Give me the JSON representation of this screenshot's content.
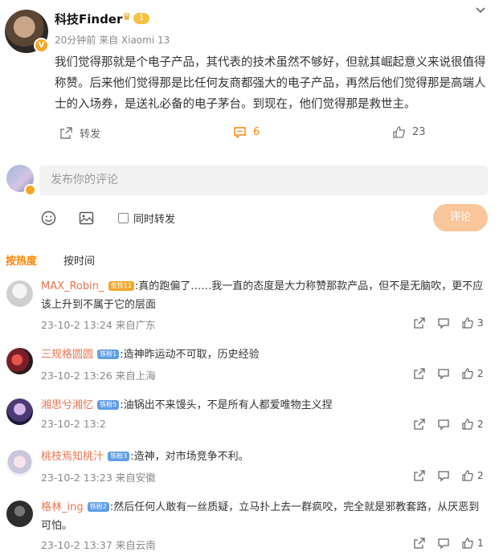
{
  "post": {
    "username": "科技Finder",
    "level": "1",
    "verified": "V",
    "time_source": "20分钟前  来自 Xiaomi 13",
    "body": "我们觉得那就是个电子产品，其代表的技术虽然不够好，但就其崛起意义来说很值得称赞。后来他们觉得那是比任何友商都强大的电子产品，再然后他们觉得那是高端人士的入场券，是送礼必备的电子茅台。到现在，他们觉得那是救世主。",
    "actions": {
      "repost_label": "转发",
      "comment_count": "6",
      "like_count": "23"
    }
  },
  "composer": {
    "placeholder": "发布你的评论",
    "also_repost_label": "同时转发",
    "submit_label": "评论"
  },
  "sort": {
    "hot_label": "按热度",
    "time_label": "按时间"
  },
  "comments": [
    {
      "name": "MAX_Robin_",
      "badge": "金铁11",
      "badge_color": "#f0a830",
      "text": ":真的跑偏了……我一直的态度是大力称赞那款产品，但不是无脑吹，更不应该上升到不属于它的层面",
      "time": "23-10-2 13:24 来自广东",
      "likes": "3"
    },
    {
      "name": "三规格圆圆",
      "badge": "铁粉1",
      "badge_color": "#5f9de8",
      "text": ":造神昨运动不可取，历史经验",
      "time": "23-10-2 13:26 来自上海",
      "likes": "2"
    },
    {
      "name": "湘思兮湘忆",
      "badge": "铁粉5",
      "badge_color": "#5f9de8",
      "text": ":油锅出不来馒头，不是所有人都爱唯物主义捏",
      "time": "23-10-2 13:2",
      "likes": "2"
    },
    {
      "name": "桃枝焉知桃汁",
      "badge": "铁粉3",
      "badge_color": "#5f9de8",
      "text": ":造神，对市场竞争不利。",
      "time": "23-10-2 13:23 来自安徽",
      "likes": "2"
    },
    {
      "name": "格林_ing",
      "badge": "铁粉2",
      "badge_color": "#5f9de8",
      "text": ":然后任何人敢有一丝质疑，立马扑上去一群疯咬，完全就是邪教套路，从厌恶到可怕。",
      "time": "23-10-2 13:37 来自云南",
      "likes": "1"
    }
  ]
}
